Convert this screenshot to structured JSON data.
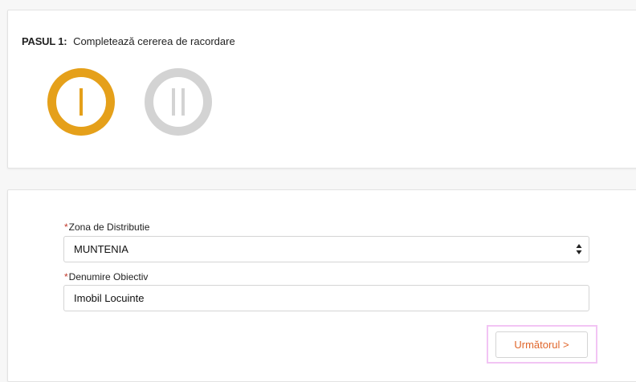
{
  "steps": {
    "prefix": "PASUL 1:",
    "title": "Completează cererea de racordare",
    "items": [
      {
        "numeral": "I",
        "state": "active",
        "color": "#e5a01a"
      },
      {
        "numeral": "II",
        "state": "inactive",
        "color": "#d3d3d3"
      }
    ]
  },
  "form": {
    "required_mark": "*",
    "zone": {
      "label": "Zona de Distributie",
      "value": "MUNTENIA"
    },
    "objective": {
      "label": "Denumire Obiectiv",
      "value": "Imobil Locuinte"
    },
    "next_label": "Următorul >"
  },
  "colors": {
    "accent": "#e5a01a",
    "inactive": "#d3d3d3",
    "next_text": "#e0662b",
    "required": "#c0392b",
    "highlight": "#f2c4f4"
  }
}
